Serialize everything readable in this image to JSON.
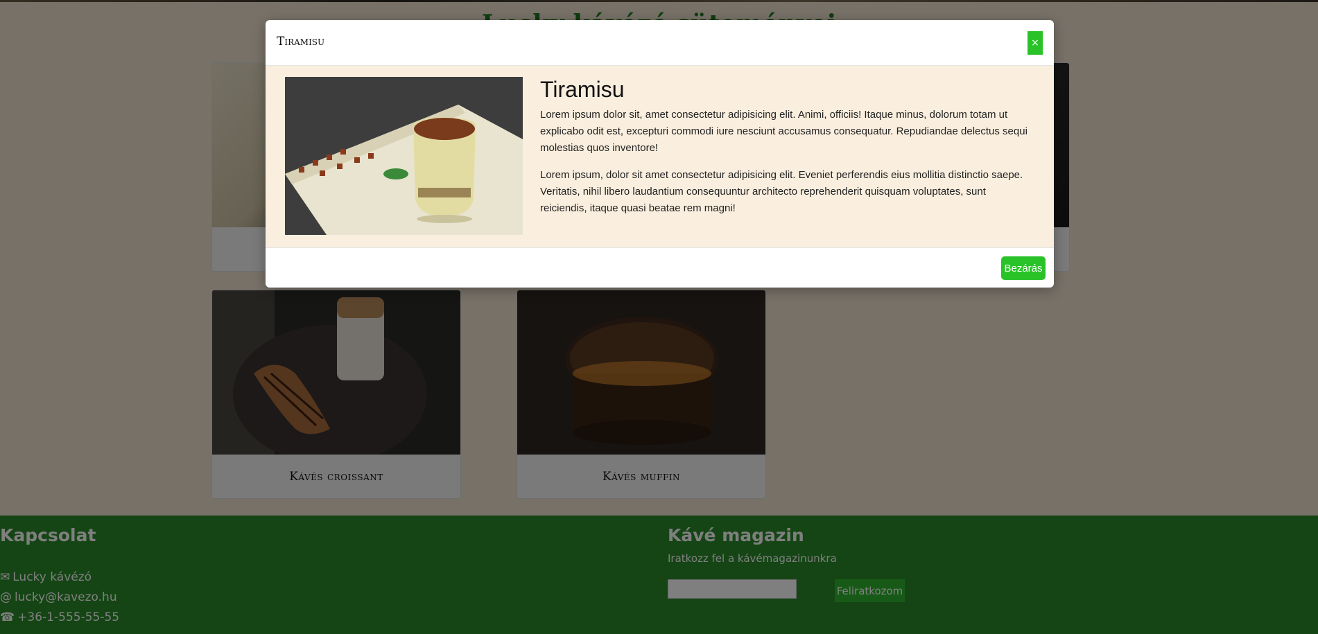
{
  "page": {
    "heading": "Lucky kávézó süteményei",
    "cards": [
      {
        "caption": "Kávés croissant"
      },
      {
        "caption": "Kávés muffin"
      }
    ]
  },
  "footer": {
    "contact_title": "Kapcsolat",
    "contact_name": "Lucky kávézó",
    "contact_email": "lucky@kavezo.hu",
    "contact_phone": "+36-1-555-55-55",
    "magazine_title": "Kávé magazin",
    "magazine_sub": "Iratkozz fel a kávémagazinunkra",
    "subscribe_label": "Feliratkozom",
    "email_placeholder": ""
  },
  "modal": {
    "title": "Tiramisu",
    "close_icon": "×",
    "heading": "Tiramisu",
    "paragraph1": "Lorem ipsum dolor sit, amet consectetur adipisicing elit. Animi, officiis! Itaque minus, dolorum totam ut explicabo odit est, excepturi commodi iure nesciunt accusamus consequatur. Repudiandae delectus sequi molestias quos inventore!",
    "paragraph2": "Lorem ipsum, dolor sit amet consectetur adipisicing elit. Eveniet perferendis eius mollitia distinctio saepe. Veritatis, nihil libero laudantium consequuntur architecto reprehenderit quisquam voluptates, sunt reiciendis, itaque quasi beatae rem magni!",
    "close_button": "Bezárás"
  },
  "colors": {
    "accent_green": "#29c329",
    "footer_green": "#2a8a2a",
    "modal_body_bg": "#faeede"
  }
}
